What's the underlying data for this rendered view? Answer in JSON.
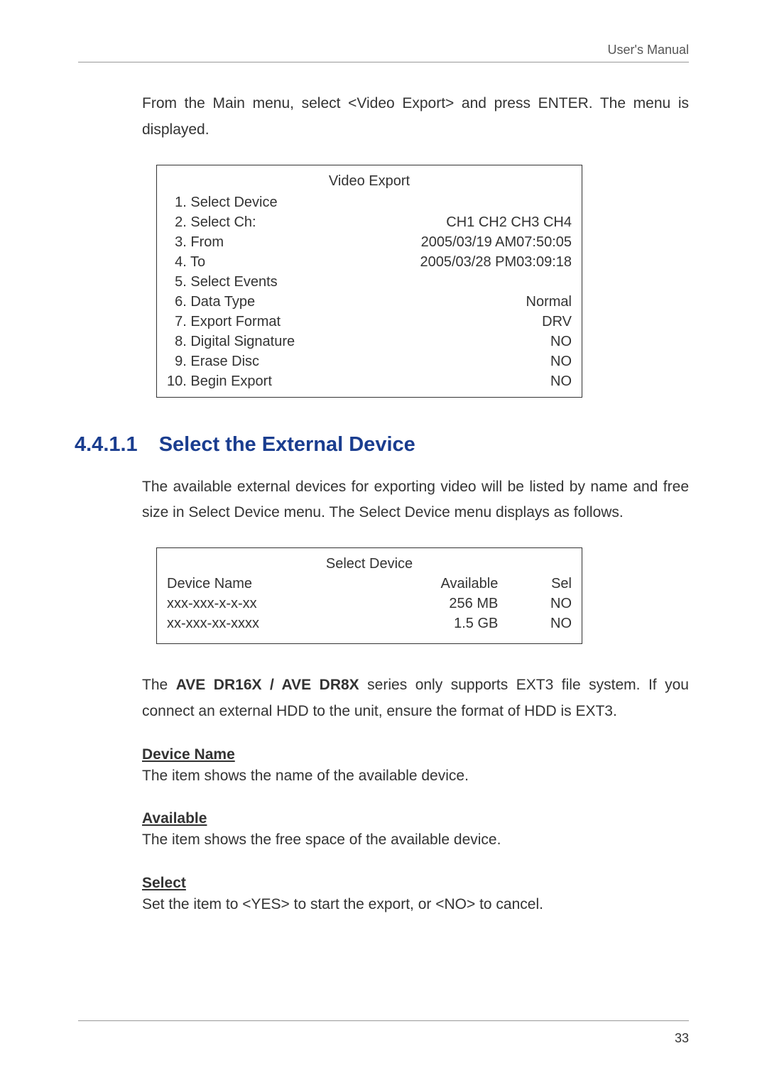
{
  "header": {
    "right_text": "User's Manual"
  },
  "intro": "From the Main menu, select <Video Export> and press ENTER. The menu is displayed.",
  "video_export_menu": {
    "title": "Video Export",
    "rows": [
      {
        "label": "  1. Select Device",
        "value": ""
      },
      {
        "label": "  2. Select Ch:",
        "value": "CH1 CH2 CH3 CH4"
      },
      {
        "label": "  3. From",
        "value": "2005/03/19 AM07:50:05"
      },
      {
        "label": "  4. To",
        "value": "2005/03/28 PM03:09:18"
      },
      {
        "label": "  5. Select Events",
        "value": ""
      },
      {
        "label": "  6. Data Type",
        "value": "Normal"
      },
      {
        "label": "  7. Export Format",
        "value": "DRV"
      },
      {
        "label": "  8. Digital Signature",
        "value": "NO"
      },
      {
        "label": "  9. Erase Disc",
        "value": "NO"
      },
      {
        "label": "10. Begin Export",
        "value": "NO"
      }
    ]
  },
  "section": {
    "number": "4.4.1.1",
    "title": "Select the External Device"
  },
  "section_intro": "The available external devices for exporting video will be listed by name and free size in Select Device menu. The Select Device menu displays as follows.",
  "select_device_menu": {
    "title": "Select Device",
    "header": {
      "c1": "Device Name",
      "c2": "Available",
      "c3": "Sel"
    },
    "rows": [
      {
        "c1": "xxx-xxx-x-x-xx",
        "c2": "256 MB",
        "c3": "NO"
      },
      {
        "c1": "xx-xxx-xx-xxxx",
        "c2": "1.5 GB",
        "c3": "NO"
      }
    ]
  },
  "ext3_note_prefix": "The ",
  "ext3_note_bold": "AVE DR16X / AVE DR8X",
  "ext3_note_suffix": " series only supports EXT3 file system. If you connect an external HDD to the unit, ensure the format of HDD is EXT3.",
  "subsections": [
    {
      "heading": "Device Name",
      "text": "The item shows the name of the available device."
    },
    {
      "heading": "Available",
      "text": "The item shows the free space of the available device."
    },
    {
      "heading": "Select",
      "text": "Set the item to <YES> to start the export, or <NO> to cancel."
    }
  ],
  "page_number": "33"
}
